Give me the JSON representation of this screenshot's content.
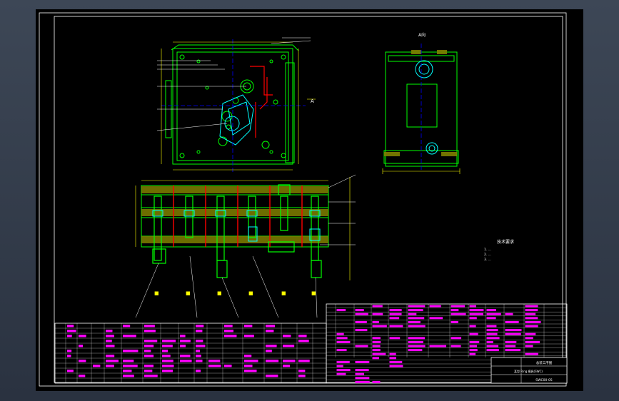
{
  "app": {
    "background_color": "#323b4a",
    "viewport_color": "#000000"
  },
  "colors": {
    "frame": "#ffffff",
    "outline": "#00ff00",
    "center": "#0000ff",
    "section": "#ff0000",
    "dim": "#ffff00",
    "part": "#00ffff",
    "table": "#ff00ff"
  },
  "drawing": {
    "direction_marker": "A",
    "top_label": "A向",
    "tech_title": "技术要求",
    "tech_notes": [
      "1. ...",
      "2. ...",
      "3. ..."
    ],
    "title_block": {
      "title": "总装工序图",
      "part_name": "某型 Ring 模具(SWC)",
      "drawing_no": "SWC00-05"
    }
  }
}
